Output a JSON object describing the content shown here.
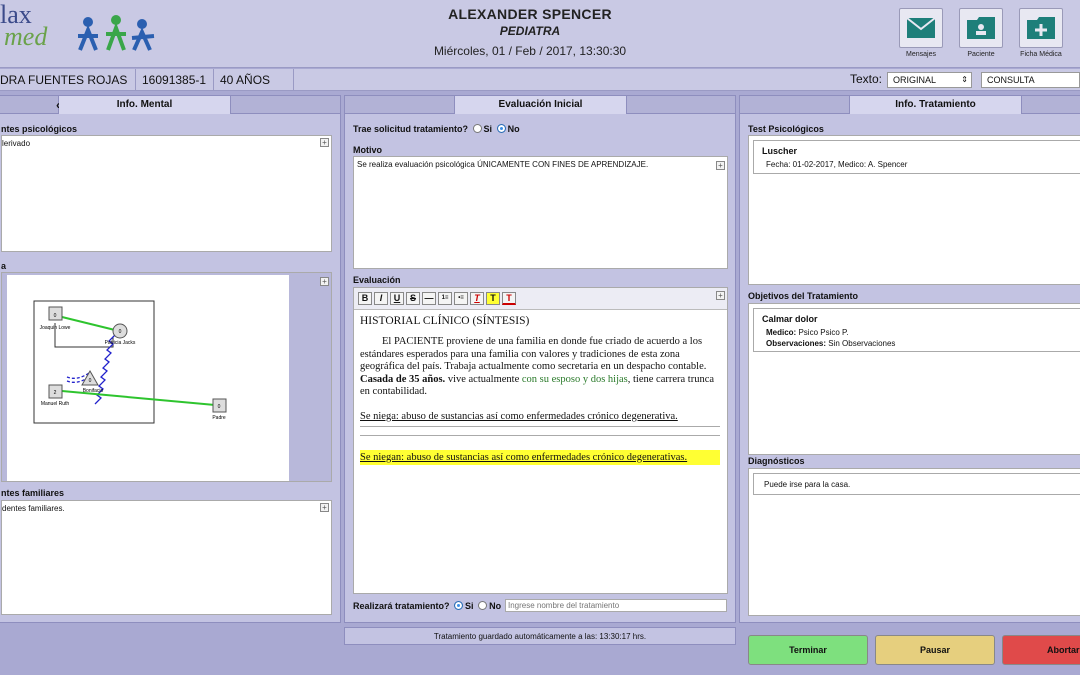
{
  "header": {
    "logo": [
      "lax",
      "med"
    ],
    "doctor_name": "ALEXANDER SPENCER",
    "specialty": "PEDIATRA",
    "datetime": "Miércoles, 01 / Feb / 2017, 13:30:30",
    "buttons": [
      {
        "label": "Mensajes",
        "icon": "envelope-icon"
      },
      {
        "label": "Paciente",
        "icon": "patient-folder-icon"
      },
      {
        "label": "Ficha Médica",
        "icon": "add-folder-icon"
      }
    ]
  },
  "patient": {
    "name": "DRA FUENTES ROJAS",
    "id": "16091385-1",
    "age": "40 AÑOS",
    "texto_label": "Texto:",
    "texto_value": "ORIGINAL",
    "mode_value": "CONSULTA"
  },
  "left_panel": {
    "tab": "Info. Mental",
    "psych_title": "ntes psicológicos",
    "psych_text": "lerivado",
    "genogram_title": "a",
    "family_title": "ntes familiares",
    "family_text": "dentes familiares.",
    "genogram": {
      "nodes": [
        {
          "label": "Joaquin Lowe",
          "num": "0"
        },
        {
          "label": "Patricia Jacks",
          "num": "0"
        },
        {
          "label": "Bonifacio",
          "num": "0"
        },
        {
          "label": "Manuel Ruth",
          "num": "2"
        },
        {
          "label": "Padre",
          "num": "0"
        }
      ]
    }
  },
  "center_panel": {
    "tab": "Evaluación Inicial",
    "request_label": "Trae solicitud tratamiento?",
    "yes": "Si",
    "no": "No",
    "request_value": "No",
    "motivo_title": "Motivo",
    "motivo_text": "Se realiza evaluación psicológica ÚNICAMENTE CON FINES DE APRENDIZAJE.",
    "evaluacion_title": "Evaluación",
    "toolbar": [
      "B",
      "I",
      "U",
      "S",
      "—",
      "1≡",
      "•≡",
      "T",
      "T",
      "T"
    ],
    "editor": {
      "heading": "HISTORIAL CLÍNICO (SÍNTESIS)",
      "p1_a": "El PACIENTE proviene de una familia en donde fue criado de acuerdo a los estándares esperados para una familia con valores y tradiciones de esta zona geográfica del país. Trabaja actualmente como secretaria en un despacho contable. ",
      "p1_bold": "Casada de 35 años.",
      "p1_b": " vive actualmente ",
      "p1_green": "con su esposo y dos hijas",
      "p1_c": ", tiene carrera trunca en contabilidad.",
      "line2": "Se niega: abuso de sustancias así como enfermedades crónico degenerativa.",
      "line3": "Se niegan: abuso de sustancias así como enfermedades crónico degenerativas."
    },
    "treat_label": "Realizará tratamiento?",
    "treat_value": "Si",
    "treat_placeholder": "Ingrese nombre del tratamiento",
    "autosave": "Tratamiento guardado automáticamente a las: 13:30:17 hrs."
  },
  "right_panel": {
    "tab": "Info. Tratamiento",
    "tests_title": "Test Psicológicos",
    "test": {
      "name": "Luscher",
      "line": "Fecha: 01-02-2017,     Medico: A. Spencer"
    },
    "objectives_title": "Objetivos del Tratamiento",
    "objective": {
      "name": "Calmar dolor",
      "medico_label": "Medico:",
      "medico": "Psico Psico P.",
      "obs_label": "Observaciones:",
      "obs": "Sin Observaciones"
    },
    "diag_title": "Diagnósticos",
    "diag_text": "Puede irse para la casa."
  },
  "actions": {
    "finish": "Terminar",
    "pause": "Pausar",
    "abort": "Abortar"
  },
  "colors": {
    "finish": "#7ee07e",
    "pause": "#e6cf7e",
    "abort": "#e04a4a",
    "highlight": "#ffff33",
    "green_text": "#2a7a2a"
  }
}
